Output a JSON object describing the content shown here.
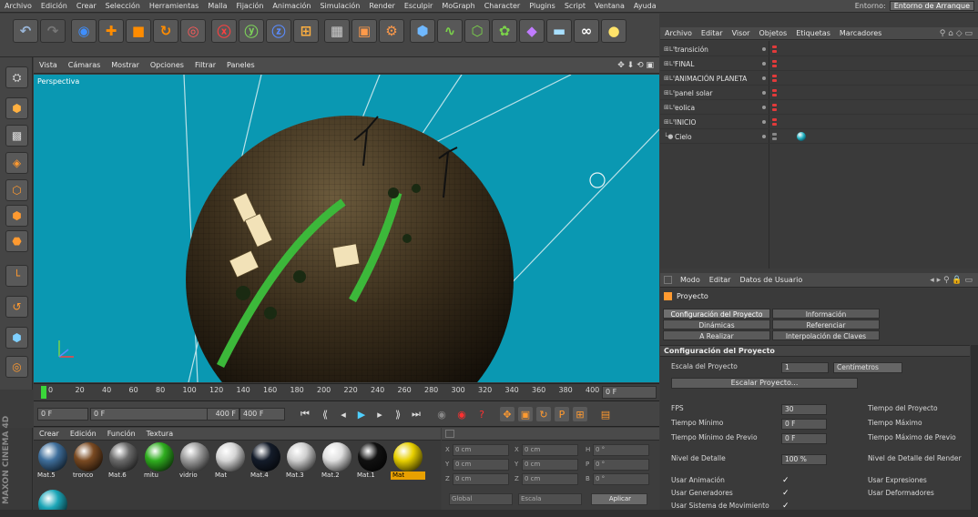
{
  "menubar": {
    "items": [
      "Archivo",
      "Edición",
      "Crear",
      "Selección",
      "Herramientas",
      "Malla",
      "Fijación",
      "Animación",
      "Simulación",
      "Render",
      "Esculpir",
      "MoGraph",
      "Character",
      "Plugins",
      "Script",
      "Ventana",
      "Ayuda"
    ],
    "env_label": "Entorno:",
    "env_value": "Entorno de Arranque"
  },
  "viewport": {
    "menu": [
      "Vista",
      "Cámaras",
      "Mostrar",
      "Opciones",
      "Filtrar",
      "Paneles"
    ],
    "label": "Perspectiva"
  },
  "timeline": {
    "ticks": [
      "0",
      "20",
      "40",
      "60",
      "80",
      "100",
      "120",
      "140",
      "160",
      "180",
      "200",
      "220",
      "240",
      "260",
      "280",
      "300",
      "320",
      "340",
      "360",
      "380",
      "400"
    ],
    "end_field": "0 F"
  },
  "playbar": {
    "start": "0 F",
    "current": "0 F",
    "end_a": "400 F",
    "end_b": "400 F"
  },
  "materials": {
    "menu": [
      "Crear",
      "Edición",
      "Función",
      "Textura"
    ],
    "items": [
      {
        "label": "Mat.5",
        "color": "#3f6f9c"
      },
      {
        "label": "tronco",
        "color": "#7a4a22"
      },
      {
        "label": "Mat.6",
        "color": "#6b6b6b"
      },
      {
        "label": "mitu",
        "color": "#2fae1f"
      },
      {
        "label": "vidrio",
        "color": "#9d9d9d"
      },
      {
        "label": "Mat",
        "color": "#d6d6d6"
      },
      {
        "label": "Mat.4",
        "color": "#141c2a"
      },
      {
        "label": "Mat.3",
        "color": "#cfcfcf"
      },
      {
        "label": "Mat.2",
        "color": "#e0e0e0"
      },
      {
        "label": "Mat.1",
        "color": "#111111"
      },
      {
        "label": "Mat",
        "color": "#e8d000"
      }
    ]
  },
  "coords": {
    "rows": [
      {
        "a": "X",
        "av": "0 cm",
        "b": "X",
        "bv": "0 cm",
        "c": "H",
        "cv": "0 °"
      },
      {
        "a": "Y",
        "av": "0 cm",
        "b": "Y",
        "bv": "0 cm",
        "c": "P",
        "cv": "0 °"
      },
      {
        "a": "Z",
        "av": "0 cm",
        "b": "Z",
        "bv": "0 cm",
        "c": "B",
        "cv": "0 °"
      }
    ],
    "mode1": "Global",
    "mode2": "Escala",
    "apply": "Aplicar"
  },
  "brand": "MAXON CINEMA 4D",
  "objects": {
    "menu": [
      "Archivo",
      "Editar",
      "Visor",
      "Objetos",
      "Etiquetas",
      "Marcadores"
    ],
    "items": [
      {
        "name": "transición"
      },
      {
        "name": "FINAL"
      },
      {
        "name": "ANIMACIÓN PLANETA"
      },
      {
        "name": "panel solar"
      },
      {
        "name": "eolica"
      },
      {
        "name": "INICIO"
      },
      {
        "name": "Cielo"
      }
    ]
  },
  "attributes": {
    "menu": [
      "Modo",
      "Editar",
      "Datos de Usuario"
    ],
    "title": "Proyecto",
    "tabs": [
      "Configuración del Proyecto",
      "Información",
      "Dinámicas",
      "Referenciar",
      "A Realizar",
      "Interpolación de Claves"
    ],
    "section": "Configuración del Proyecto",
    "scale_label": "Escala del Proyecto",
    "scale_value": "1",
    "scale_unit": "Centímetros",
    "scale_button": "Escalar Proyecto...",
    "rows": [
      {
        "label": "FPS",
        "value": "30",
        "right": "Tiempo del Proyecto"
      },
      {
        "label": "Tiempo Mínimo",
        "value": "0 F",
        "right": "Tiempo Máximo"
      },
      {
        "label": "Tiempo Mínimo de Previo",
        "value": "0 F",
        "right": "Tiempo Máximo de Previo"
      },
      {
        "label": "Nivel de Detalle",
        "value": "100 %",
        "right": "Nivel de Detalle del Render"
      }
    ],
    "checks": [
      {
        "label": "Usar Animación",
        "right": "Usar Expresiones"
      },
      {
        "label": "Usar Generadores",
        "right": "Usar Deformadores"
      },
      {
        "label": "Usar Sistema de Movimiento",
        "right": ""
      }
    ]
  }
}
